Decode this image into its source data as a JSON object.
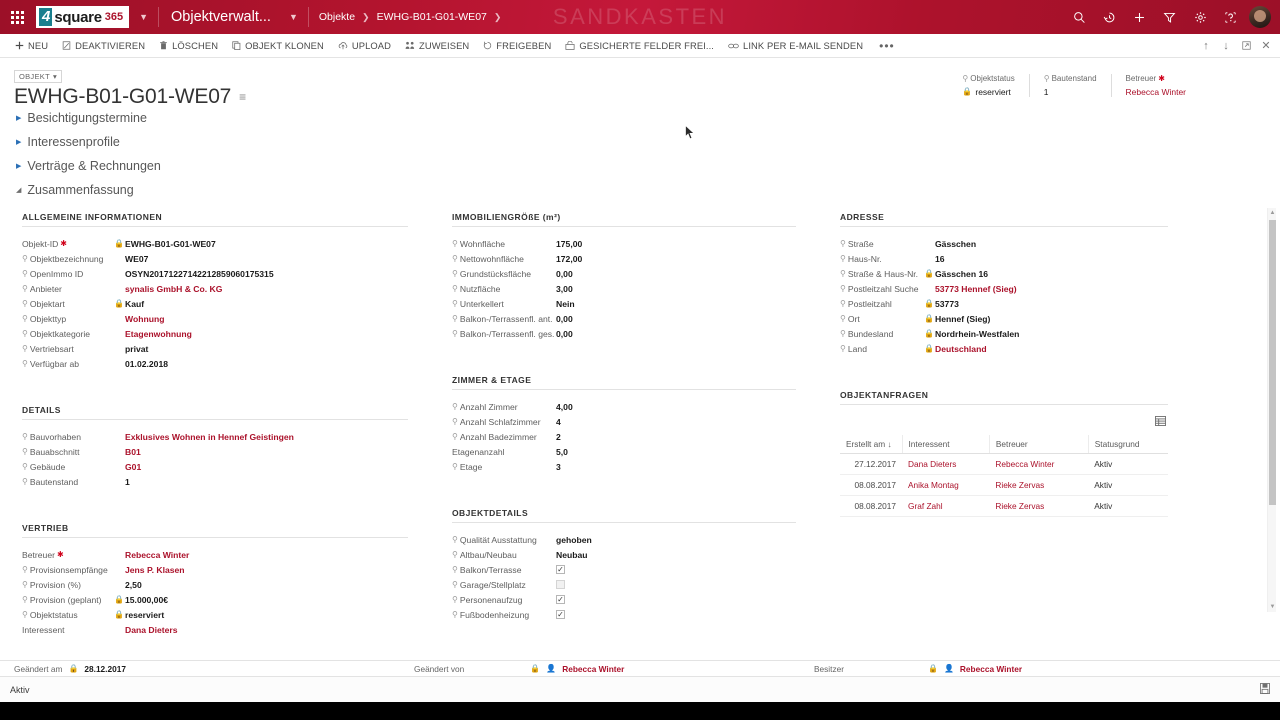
{
  "topnav": {
    "waffle_label": "App-Starter",
    "brand": {
      "mark": "4",
      "name": "square",
      "suffix": "365"
    },
    "app_title": "Objektverwalt...",
    "breadcrumbs": [
      "Objekte",
      "EWHG-B01-G01-WE07"
    ],
    "watermark": "SANDKASTEN",
    "icons": [
      "search-icon",
      "recent-icon",
      "quick-create-icon",
      "advanced-find-icon",
      "settings-gear-icon",
      "help-icon"
    ]
  },
  "commandbar": {
    "items": [
      {
        "label": "NEU",
        "icon": "plus-icon"
      },
      {
        "label": "DEAKTIVIEREN",
        "icon": "deactivate-icon"
      },
      {
        "label": "LÖSCHEN",
        "icon": "trash-icon"
      },
      {
        "label": "OBJEKT KLONEN",
        "icon": "copy-icon"
      },
      {
        "label": "UPLOAD",
        "icon": "upload-icon"
      },
      {
        "label": "ZUWEISEN",
        "icon": "assign-icon"
      },
      {
        "label": "FREIGEBEN",
        "icon": "share-icon"
      },
      {
        "label": "GESICHERTE FELDER FREI...",
        "icon": "unlock-fields-icon"
      },
      {
        "label": "LINK PER E-MAIL SENDEN",
        "icon": "link-icon"
      }
    ],
    "overflow": "•••",
    "right_icons": [
      "previous-record-icon",
      "next-record-icon",
      "popout-icon",
      "close-icon"
    ]
  },
  "record": {
    "entity_tag": "OBJEKT",
    "title": "EWHG-B01-G01-WE07",
    "header_fields": [
      {
        "label": "Objektstatus",
        "value": "reserviert",
        "locked": true,
        "pinned": true,
        "link": false
      },
      {
        "label": "Bautenstand",
        "value": "1",
        "locked": false,
        "pinned": true,
        "link": false
      },
      {
        "label": "Betreuer",
        "value": "Rebecca Winter",
        "required": true,
        "locked": false,
        "pinned": false,
        "link": true
      }
    ]
  },
  "sections": [
    {
      "label": "Besichtigungstermine",
      "expanded": false
    },
    {
      "label": "Interessenprofile",
      "expanded": false
    },
    {
      "label": "Verträge & Rechnungen",
      "expanded": false
    },
    {
      "label": "Zusammenfassung",
      "expanded": true
    }
  ],
  "allgemeine_informationen": {
    "title": "ALLGEMEINE INFORMATIONEN",
    "fields": [
      {
        "label": "Objekt-ID",
        "value": "EWHG-B01-G01-WE07",
        "required": true,
        "locked": true,
        "pinned": false,
        "link": false
      },
      {
        "label": "Objektbezeichnung",
        "value": "WE07",
        "locked": false,
        "pinned": true,
        "link": false
      },
      {
        "label": "OpenImmo ID",
        "value": "OSYN20171227142212859060175315",
        "locked": false,
        "pinned": true,
        "link": false
      },
      {
        "label": "Anbieter",
        "value": "synalis GmbH & Co. KG",
        "locked": false,
        "pinned": true,
        "link": true
      },
      {
        "label": "Objektart",
        "value": "Kauf",
        "locked": true,
        "pinned": true,
        "link": false
      },
      {
        "label": "Objekttyp",
        "value": "Wohnung",
        "locked": false,
        "pinned": true,
        "link": true
      },
      {
        "label": "Objektkategorie",
        "value": "Etagenwohnung",
        "locked": false,
        "pinned": true,
        "link": true
      },
      {
        "label": "Vertriebsart",
        "value": "privat",
        "locked": false,
        "pinned": true,
        "link": false
      },
      {
        "label": "Verfügbar ab",
        "value": "01.02.2018",
        "locked": false,
        "pinned": true,
        "link": false
      }
    ]
  },
  "details": {
    "title": "DETAILS",
    "fields": [
      {
        "label": "Bauvorhaben",
        "value": "Exklusives Wohnen in Hennef Geistingen",
        "locked": false,
        "pinned": true,
        "link": true
      },
      {
        "label": "Bauabschnitt",
        "value": "B01",
        "locked": false,
        "pinned": true,
        "link": true
      },
      {
        "label": "Gebäude",
        "value": "G01",
        "locked": false,
        "pinned": true,
        "link": true
      },
      {
        "label": "Bautenstand",
        "value": "1",
        "locked": false,
        "pinned": true,
        "link": false
      }
    ]
  },
  "vertrieb": {
    "title": "VERTRIEB",
    "fields": [
      {
        "label": "Betreuer",
        "value": "Rebecca Winter",
        "required": true,
        "locked": false,
        "pinned": false,
        "link": true
      },
      {
        "label": "Provisionsempfänge",
        "value": "Jens P. Klasen",
        "locked": false,
        "pinned": true,
        "link": true
      },
      {
        "label": "Provision (%)",
        "value": "2,50",
        "locked": false,
        "pinned": true,
        "link": false
      },
      {
        "label": "Provision (geplant)",
        "value": "15.000,00€",
        "locked": true,
        "pinned": true,
        "link": false
      },
      {
        "label": "Objektstatus",
        "value": "reserviert",
        "locked": true,
        "pinned": true,
        "link": false
      },
      {
        "label": "Interessent",
        "value": "Dana Dieters",
        "locked": false,
        "pinned": false,
        "link": true
      }
    ]
  },
  "immobiliengroesse": {
    "title": "IMMOBILIENGRÖßE (m²)",
    "fields": [
      {
        "label": "Wohnfläche",
        "value": "175,00",
        "pinned": true,
        "locked": false,
        "link": false
      },
      {
        "label": "Nettowohnfläche",
        "value": "172,00",
        "pinned": true,
        "locked": false,
        "link": false
      },
      {
        "label": "Grundstücksfläche",
        "value": "0,00",
        "pinned": true,
        "locked": false,
        "link": false
      },
      {
        "label": "Nutzfläche",
        "value": "3,00",
        "pinned": true,
        "locked": false,
        "link": false
      },
      {
        "label": "Unterkellert",
        "value": "Nein",
        "pinned": true,
        "locked": false,
        "link": false
      },
      {
        "label": "Balkon-/Terrassenfl. ant.",
        "value": "0,00",
        "pinned": true,
        "locked": false,
        "link": false
      },
      {
        "label": "Balkon-/Terrassenfl. ges.",
        "value": "0,00",
        "pinned": true,
        "locked": false,
        "link": false
      }
    ]
  },
  "zimmer_etage": {
    "title": "ZIMMER & ETAGE",
    "fields": [
      {
        "label": "Anzahl Zimmer",
        "value": "4,00",
        "pinned": true,
        "locked": false,
        "link": false
      },
      {
        "label": "Anzahl Schlafzimmer",
        "value": "4",
        "pinned": true,
        "locked": false,
        "link": false
      },
      {
        "label": "Anzahl Badezimmer",
        "value": "2",
        "pinned": true,
        "locked": false,
        "link": false
      },
      {
        "label": "Etagenanzahl",
        "value": "5,0",
        "pinned": false,
        "locked": false,
        "link": false
      },
      {
        "label": "Etage",
        "value": "3",
        "pinned": true,
        "locked": false,
        "link": false
      }
    ]
  },
  "objektdetails": {
    "title": "OBJEKTDETAILS",
    "fields": [
      {
        "label": "Qualität Ausstattung",
        "value": "gehoben",
        "pinned": true,
        "locked": false,
        "link": false,
        "type": "text"
      },
      {
        "label": "Altbau/Neubau",
        "value": "Neubau",
        "pinned": true,
        "locked": false,
        "link": false,
        "type": "text"
      },
      {
        "label": "Balkon/Terrasse",
        "checked": true,
        "pinned": true,
        "locked": false,
        "type": "checkbox"
      },
      {
        "label": "Garage/Stellplatz",
        "checked": false,
        "pinned": true,
        "locked": false,
        "type": "checkbox",
        "disabled": true
      },
      {
        "label": "Personenaufzug",
        "checked": true,
        "pinned": true,
        "locked": false,
        "type": "checkbox"
      },
      {
        "label": "Fußbodenheizung",
        "checked": true,
        "pinned": true,
        "locked": false,
        "type": "checkbox"
      }
    ]
  },
  "adresse": {
    "title": "ADRESSE",
    "fields": [
      {
        "label": "Straße",
        "value": "Gässchen",
        "pinned": true,
        "locked": false,
        "link": false
      },
      {
        "label": "Haus-Nr.",
        "value": "16",
        "pinned": true,
        "locked": false,
        "link": false
      },
      {
        "label": "Straße & Haus-Nr.",
        "value": "Gässchen 16",
        "pinned": true,
        "locked": true,
        "link": false
      },
      {
        "label": "Postleitzahl Suche",
        "value": "53773 Hennef (Sieg)",
        "pinned": true,
        "locked": false,
        "link": true
      },
      {
        "label": "Postleitzahl",
        "value": "53773",
        "pinned": true,
        "locked": true,
        "link": false
      },
      {
        "label": "Ort",
        "value": "Hennef (Sieg)",
        "pinned": true,
        "locked": true,
        "link": false
      },
      {
        "label": "Bundesland",
        "value": "Nordrhein-Westfalen",
        "pinned": true,
        "locked": true,
        "link": false
      },
      {
        "label": "Land",
        "value": "Deutschland",
        "pinned": true,
        "locked": true,
        "link": true
      }
    ]
  },
  "objektanfragen": {
    "title": "OBJEKTANFRAGEN",
    "grid_icon": "grid-view-icon",
    "columns": [
      "Erstellt am ↓",
      "Interessent",
      "Betreuer",
      "Statusgrund"
    ],
    "rows": [
      {
        "erstellt_am": "27.12.2017",
        "interessent": "Dana Dieters",
        "betreuer": "Rebecca Winter",
        "statusgrund": "Aktiv"
      },
      {
        "erstellt_am": "08.08.2017",
        "interessent": "Anika Montag",
        "betreuer": "Rieke Zervas",
        "statusgrund": "Aktiv"
      },
      {
        "erstellt_am": "08.08.2017",
        "interessent": "Graf Zahl",
        "betreuer": "Rieke Zervas",
        "statusgrund": "Aktiv"
      }
    ]
  },
  "meta": {
    "geaendert_am_label": "Geändert am",
    "geaendert_am_value": "28.12.2017",
    "geaendert_von_label": "Geändert von",
    "geaendert_von_value": "Rebecca Winter",
    "besitzer_label": "Besitzer",
    "besitzer_value": "Rebecca Winter"
  },
  "statusbar": {
    "status": "Aktiv",
    "save_icon": "save-icon"
  },
  "colors": {
    "brand_red": "#AB122B",
    "link_red": "#AB122B",
    "teal": "#1a7f8e",
    "label_gray": "#5e5e5e"
  }
}
